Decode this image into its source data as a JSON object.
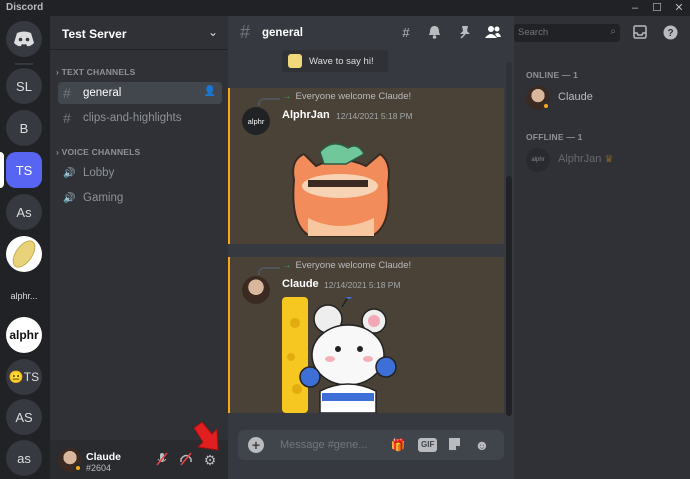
{
  "titlebar": {
    "app_title": "Discord",
    "minimize": "–",
    "maximize": "☐",
    "close": "✕"
  },
  "servers": [
    {
      "label": "SL"
    },
    {
      "label": "B"
    },
    {
      "label": "TS"
    },
    {
      "label": "As"
    },
    {
      "label": ""
    },
    {
      "label": "alphr..."
    },
    {
      "label": "alphr"
    },
    {
      "label": "😐TS"
    },
    {
      "label": "AS"
    },
    {
      "label": "as"
    }
  ],
  "sidebar": {
    "server_name": "Test Server",
    "text_category": "TEXT CHANNELS",
    "voice_category": "VOICE CHANNELS",
    "text_channels": [
      {
        "label": "general"
      },
      {
        "label": "clips-and-highlights"
      }
    ],
    "voice_channels": [
      {
        "label": "Lobby"
      },
      {
        "label": "Gaming"
      }
    ]
  },
  "user": {
    "name": "Claude",
    "tag": "#2604"
  },
  "chat": {
    "channel": "general",
    "wave_text": "Wave to say hi!",
    "messages": [
      {
        "system": "Everyone welcome Claude!",
        "author": "AlphrJan",
        "timestamp": "12/14/2021 5:18 PM",
        "avatar_text": "alphr"
      },
      {
        "system": "Everyone welcome Claude!",
        "author": "Claude",
        "timestamp": "12/14/2021 5:18 PM"
      }
    ],
    "placeholder": "Message #gene...",
    "gif_label": "GIF"
  },
  "header": {
    "search_placeholder": "Search"
  },
  "members": {
    "online_heading": "ONLINE — 1",
    "offline_heading": "OFFLINE — 1",
    "online": [
      {
        "name": "Claude"
      }
    ],
    "offline": [
      {
        "name": "AlphrJan",
        "avatar_text": "alphr",
        "badge": "♛"
      }
    ]
  },
  "colors": {
    "accent": "#5865f2",
    "mention_bar": "#faa81a",
    "pointer": "#e02020"
  }
}
